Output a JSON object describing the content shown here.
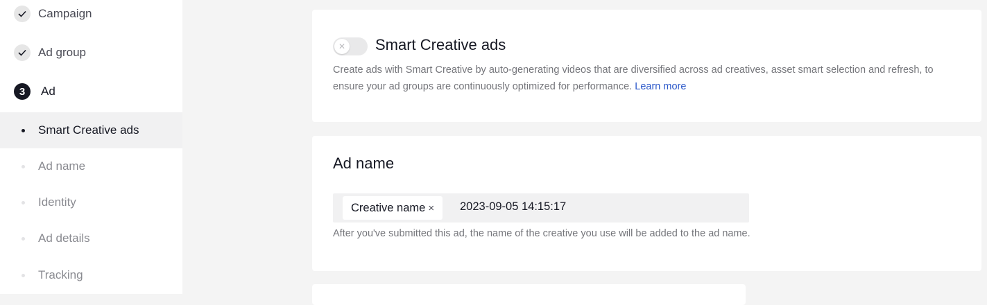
{
  "sidebar": {
    "steps": [
      {
        "label": "Campaign",
        "state": "done",
        "icon": "check-icon"
      },
      {
        "label": "Ad group",
        "state": "done",
        "icon": "check-icon"
      },
      {
        "label": "Ad",
        "state": "active",
        "number": "3"
      }
    ],
    "sub_items": [
      {
        "label": "Smart Creative ads",
        "active": true
      },
      {
        "label": "Ad name",
        "active": false
      },
      {
        "label": "Identity",
        "active": false
      },
      {
        "label": "Ad details",
        "active": false
      },
      {
        "label": "Tracking",
        "active": false
      }
    ]
  },
  "smart_creative": {
    "title": "Smart Creative ads",
    "toggle_on": false,
    "description": "Create ads with Smart Creative by auto-generating videos that are diversified across ad creatives, asset smart selection and refresh, to ensure your ad groups are continuously optimized for performance.",
    "learn_more": "Learn more"
  },
  "ad_name": {
    "title": "Ad name",
    "chip_label": "Creative name",
    "value": "2023-09-05 14:15:17",
    "helper": "After you've submitted this ad, the name of the creative you use will be added to the ad name."
  },
  "colors": {
    "accent_link": "#2a57c9",
    "active_step": "#161823",
    "page_bg": "#f4f4f4"
  }
}
